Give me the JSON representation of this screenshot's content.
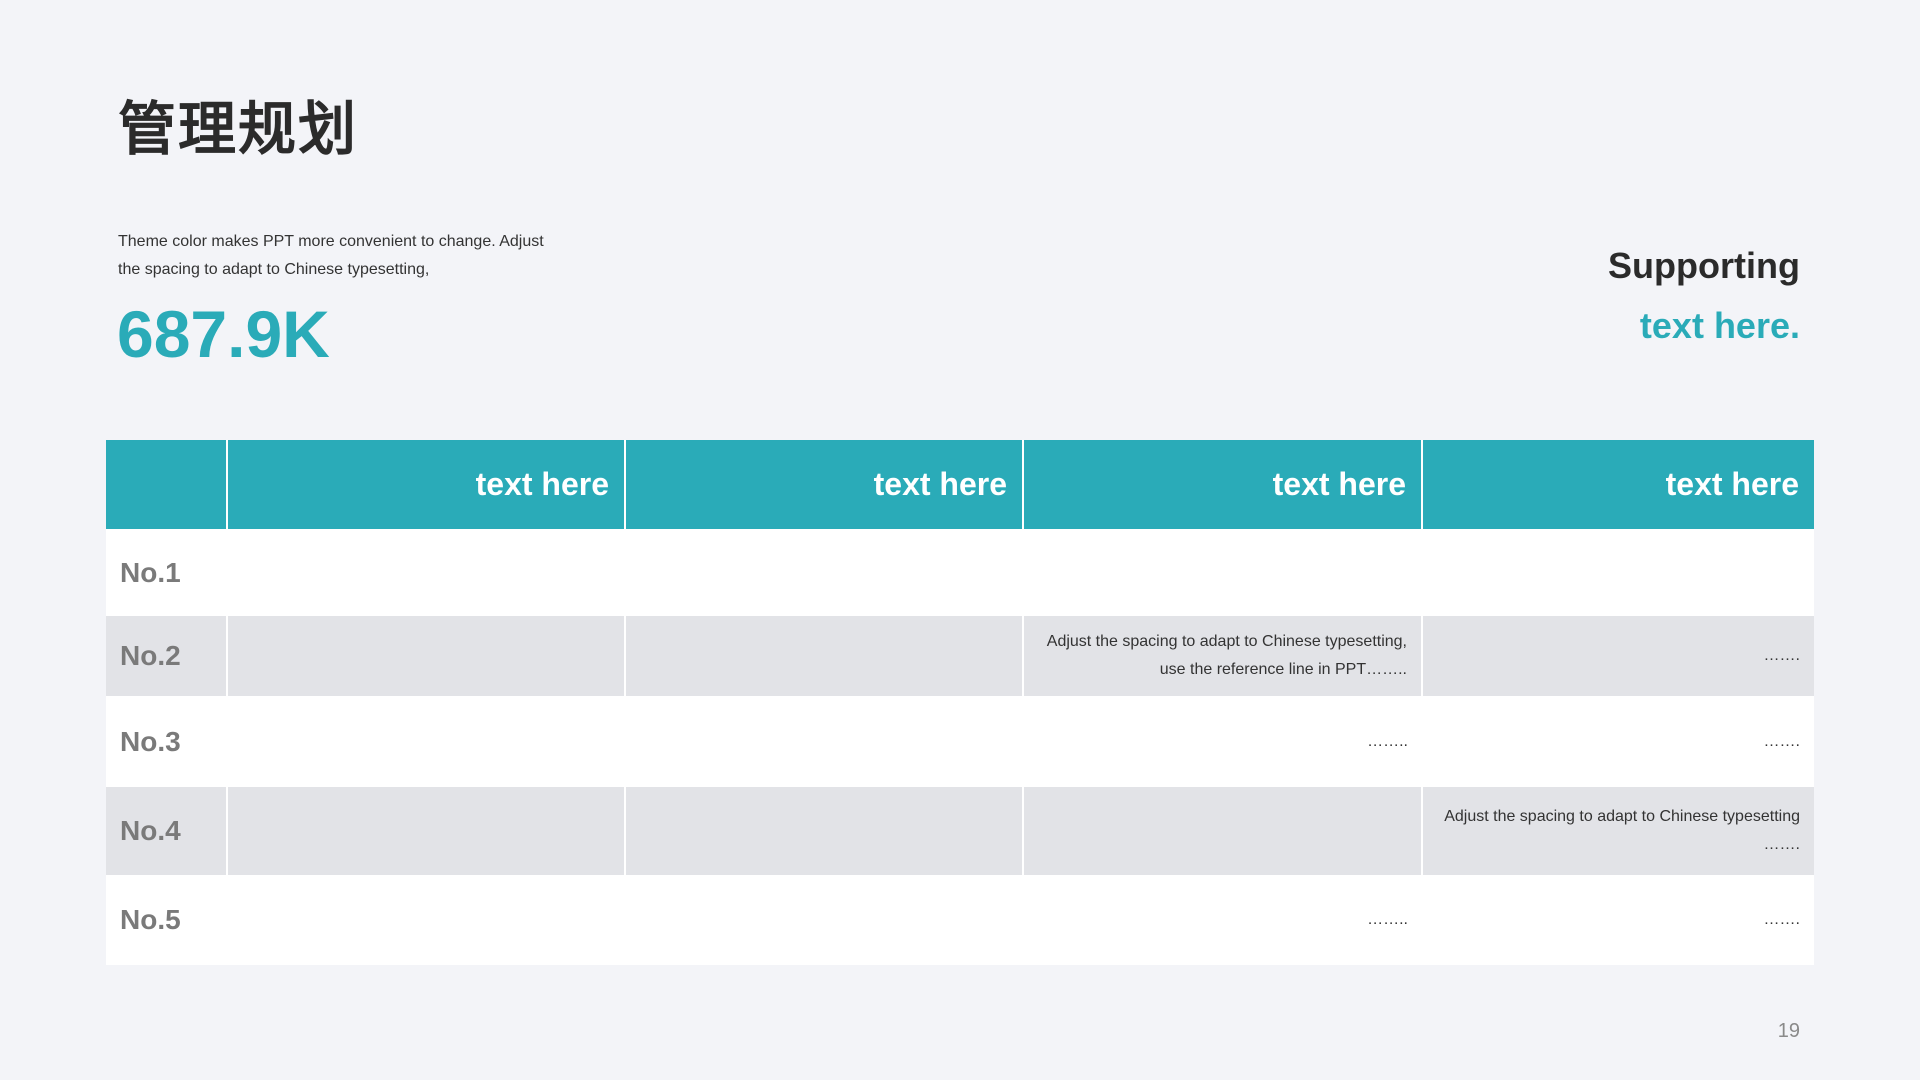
{
  "title": "管理规划",
  "description": "Theme color makes PPT more convenient  to change.  Adjust the spacing to adapt to Chinese typesetting,",
  "metric": "687.9K",
  "supporting": {
    "line1": "Supporting",
    "line2": "text here."
  },
  "table": {
    "headers": [
      "",
      "text here",
      "text here",
      "text here",
      "text here"
    ],
    "rows": [
      {
        "label": "No.1",
        "cells": [
          "",
          "",
          "",
          ""
        ]
      },
      {
        "label": "No.2",
        "cells": [
          "",
          "",
          "Adjust the spacing to adapt to Chinese typesetting, use the reference line in PPT……..",
          "……."
        ]
      },
      {
        "label": "No.3",
        "cells": [
          "",
          "",
          "……..",
          "……."
        ]
      },
      {
        "label": "No.4",
        "cells": [
          "",
          "",
          "",
          "Adjust the spacing to adapt to Chinese typesetting ……."
        ]
      },
      {
        "label": "No.5",
        "cells": [
          "",
          "",
          "……..",
          "……."
        ]
      }
    ]
  },
  "page_number": "19",
  "colors": {
    "accent": "#2aabb8",
    "background": "#f3f4f8",
    "row_alt": "#e2e3e7",
    "title": "#2b2b2b"
  }
}
